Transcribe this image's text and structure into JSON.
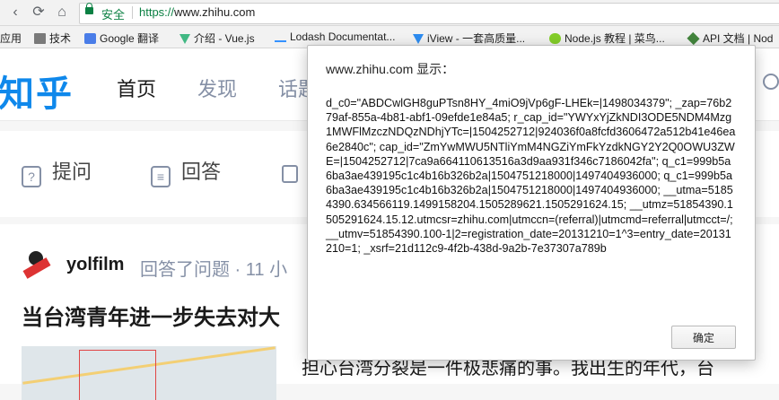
{
  "browser": {
    "secure_label": "安全",
    "url_scheme": "https://",
    "url_host": "www.zhihu.com",
    "back_glyph": "‹",
    "reload_glyph": "⟳",
    "home_glyph": "⌂"
  },
  "bookmarks": [
    {
      "label": "应用",
      "icon": "apps-icon"
    },
    {
      "label": "技术",
      "icon": "folder-icon"
    },
    {
      "label": "Google 翻译",
      "icon": "google-translate-icon"
    },
    {
      "label": "介绍 - Vue.js",
      "icon": "vue-icon"
    },
    {
      "label": "Lodash Documentat...",
      "icon": "lodash-icon"
    },
    {
      "label": "iView - 一套高质量...",
      "icon": "iview-icon"
    },
    {
      "label": "Node.js 教程 | 菜鸟...",
      "icon": "nodejs-icon"
    },
    {
      "label": "API 文档 | Nod",
      "icon": "api-docs-icon"
    }
  ],
  "site": {
    "logo": "知乎",
    "nav": [
      "首页",
      "发现",
      "话题"
    ],
    "actions": [
      "提问",
      "回答"
    ],
    "action_icons": [
      "?",
      "≡"
    ],
    "feed": {
      "author": "yolfilm",
      "meta": "回答了问题 · 11 小",
      "title": "当台湾青年进一步失去对大",
      "excerpt": "担心台湾分裂是一件极悲痛的事。我出生的年代，台"
    }
  },
  "dialog": {
    "title": "www.zhihu.com 显示：",
    "message": "d_c0=\"ABDCwlGH8guPTsn8HY_4miO9jVp6gF-LHEk=|1498034379\"; _zap=76b279af-855a-4b81-abf1-09efde1e84a5; r_cap_id=\"YWYxYjZkNDI3ODE5NDM4Mzg1MWFlMzczNDQzNDhjYTc=|1504252712|924036f0a8fcfd3606472a512b41e46ea6e2840c\"; cap_id=\"ZmYwMWU5NTliYmM4NGZiYmFkYzdkNGY2Y2Q0OWU3ZWE=|1504252712|7ca9a664110613516a3d9aa931f346c7186042fa\"; q_c1=999b5a6ba3ae439195c1c4b16b326b2a|1504751218000|1497404936000; q_c1=999b5a6ba3ae439195c1c4b16b326b2a|1504751218000|1497404936000; __utma=51854390.634566119.1499158204.1505289621.1505291624.15; __utmz=51854390.1505291624.15.12.utmcsr=zhihu.com|utmccn=(referral)|utmcmd=referral|utmcct=/; __utmv=51854390.100-1|2=registration_date=20131210=1^3=entry_date=20131210=1; _xsrf=21d112c9-4f2b-438d-9a2b-7e37307a789b",
    "ok_label": "确定"
  }
}
